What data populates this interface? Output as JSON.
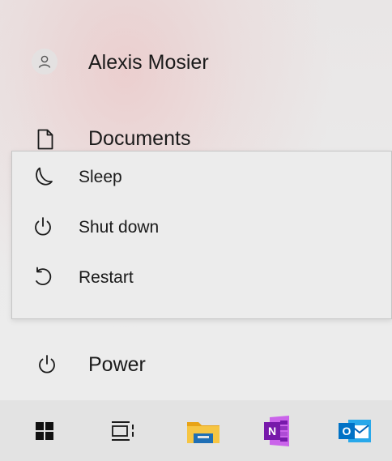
{
  "user": {
    "name": "Alexis Mosier",
    "icon": "person-icon"
  },
  "documents": {
    "label": "Documents",
    "icon": "document-icon"
  },
  "power_menu": {
    "items": [
      {
        "label": "Sleep",
        "icon": "moon-icon"
      },
      {
        "label": "Shut down",
        "icon": "power-icon"
      },
      {
        "label": "Restart",
        "icon": "restart-icon"
      }
    ]
  },
  "power": {
    "label": "Power",
    "icon": "power-icon"
  },
  "taskbar": {
    "items": [
      {
        "name": "Start",
        "icon": "windows-logo-icon"
      },
      {
        "name": "Task View",
        "icon": "task-view-icon"
      },
      {
        "name": "File Explorer",
        "icon": "folder-icon",
        "color": "#f3b61f"
      },
      {
        "name": "OneNote",
        "icon": "onenote-icon",
        "color": "#7719aa",
        "badge": "N"
      },
      {
        "name": "Outlook",
        "icon": "outlook-icon",
        "color": "#0072c6",
        "badge": "O"
      }
    ]
  }
}
